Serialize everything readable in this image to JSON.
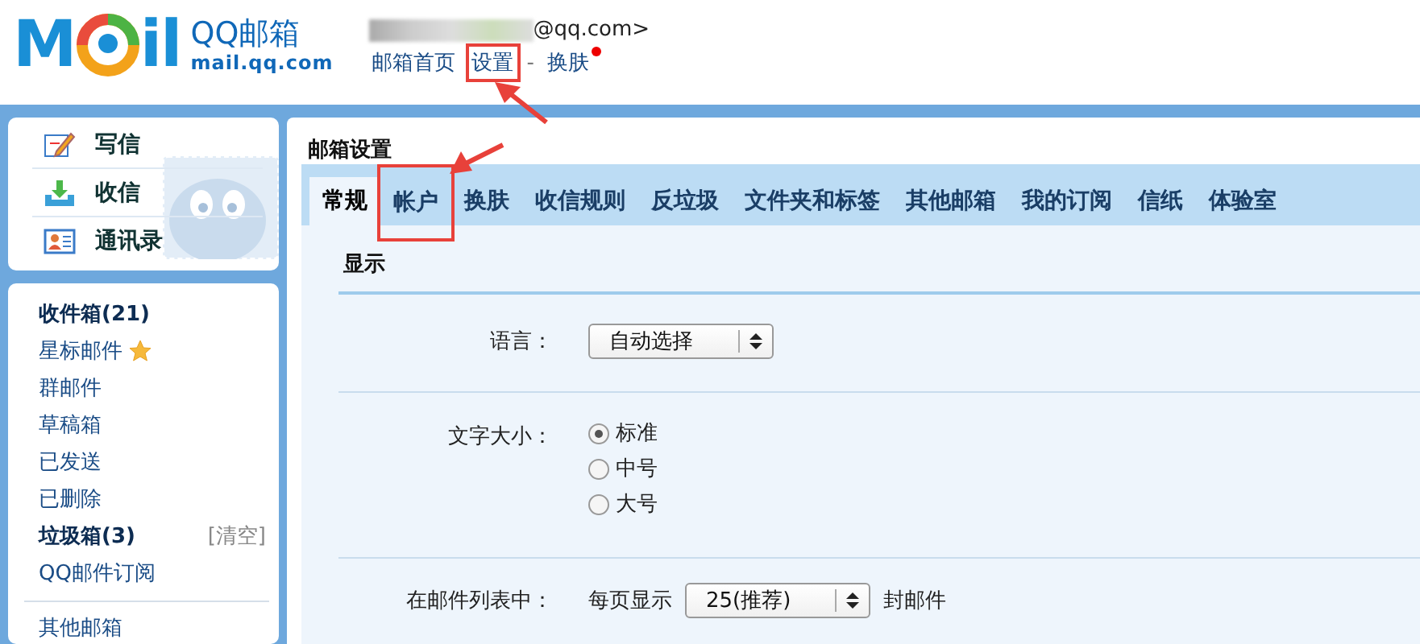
{
  "header": {
    "logo": {
      "left": "M",
      "right": "il"
    },
    "brand": "QQ邮箱",
    "domain": "mail.qq.com",
    "account": "@qq.com>",
    "links": [
      {
        "kind": "link",
        "label": "邮箱首页",
        "highlighted": false,
        "notification": false
      },
      {
        "kind": "link",
        "label": "设置",
        "highlighted": true,
        "notification": false
      },
      {
        "kind": "separator",
        "label": "-"
      },
      {
        "kind": "link",
        "label": "换肤",
        "highlighted": false,
        "notification": true
      }
    ]
  },
  "sidebar": {
    "actions": [
      {
        "label": "写信"
      },
      {
        "label": "收信"
      },
      {
        "label": "通讯录"
      }
    ],
    "folders": [
      {
        "label": "收件箱(21)",
        "unread": true,
        "starred": false
      },
      {
        "label": "星标邮件",
        "unread": false,
        "starred": true
      },
      {
        "label": "群邮件",
        "unread": false,
        "starred": false
      },
      {
        "label": "草稿箱",
        "unread": false,
        "starred": false
      },
      {
        "label": "已发送",
        "unread": false,
        "starred": false
      },
      {
        "label": "已删除",
        "unread": false,
        "starred": false
      },
      {
        "label": "垃圾箱(3)",
        "unread": true,
        "starred": false,
        "action": "[清空]"
      },
      {
        "label": "QQ邮件订阅",
        "unread": false,
        "starred": false
      }
    ],
    "other_folders": [
      {
        "label": "其他邮箱"
      }
    ]
  },
  "main": {
    "title": "邮箱设置",
    "tabs": [
      {
        "label": "常规",
        "selected": true,
        "highlighted": false
      },
      {
        "label": "帐户",
        "selected": false,
        "highlighted": true
      },
      {
        "label": "换肤",
        "selected": false,
        "highlighted": false
      },
      {
        "label": "收信规则",
        "selected": false,
        "highlighted": false
      },
      {
        "label": "反垃圾",
        "selected": false,
        "highlighted": false
      },
      {
        "label": "文件夹和标签",
        "selected": false,
        "highlighted": false
      },
      {
        "label": "其他邮箱",
        "selected": false,
        "highlighted": false
      },
      {
        "label": "我的订阅",
        "selected": false,
        "highlighted": false
      },
      {
        "label": "信纸",
        "selected": false,
        "highlighted": false
      },
      {
        "label": "体验室",
        "selected": false,
        "highlighted": false
      }
    ],
    "section": "显示",
    "rows": [
      {
        "kind": "select",
        "label": "语言：",
        "value": "自动选择"
      },
      {
        "kind": "radio",
        "label": "文字大小：",
        "options": [
          {
            "label": "标准",
            "selected": true
          },
          {
            "label": "中号",
            "selected": false
          },
          {
            "label": "大号",
            "selected": false
          }
        ]
      },
      {
        "kind": "select",
        "label": "在邮件列表中：",
        "prefix": "每页显示",
        "value": "25(推荐)",
        "suffix": "封邮件"
      }
    ]
  }
}
